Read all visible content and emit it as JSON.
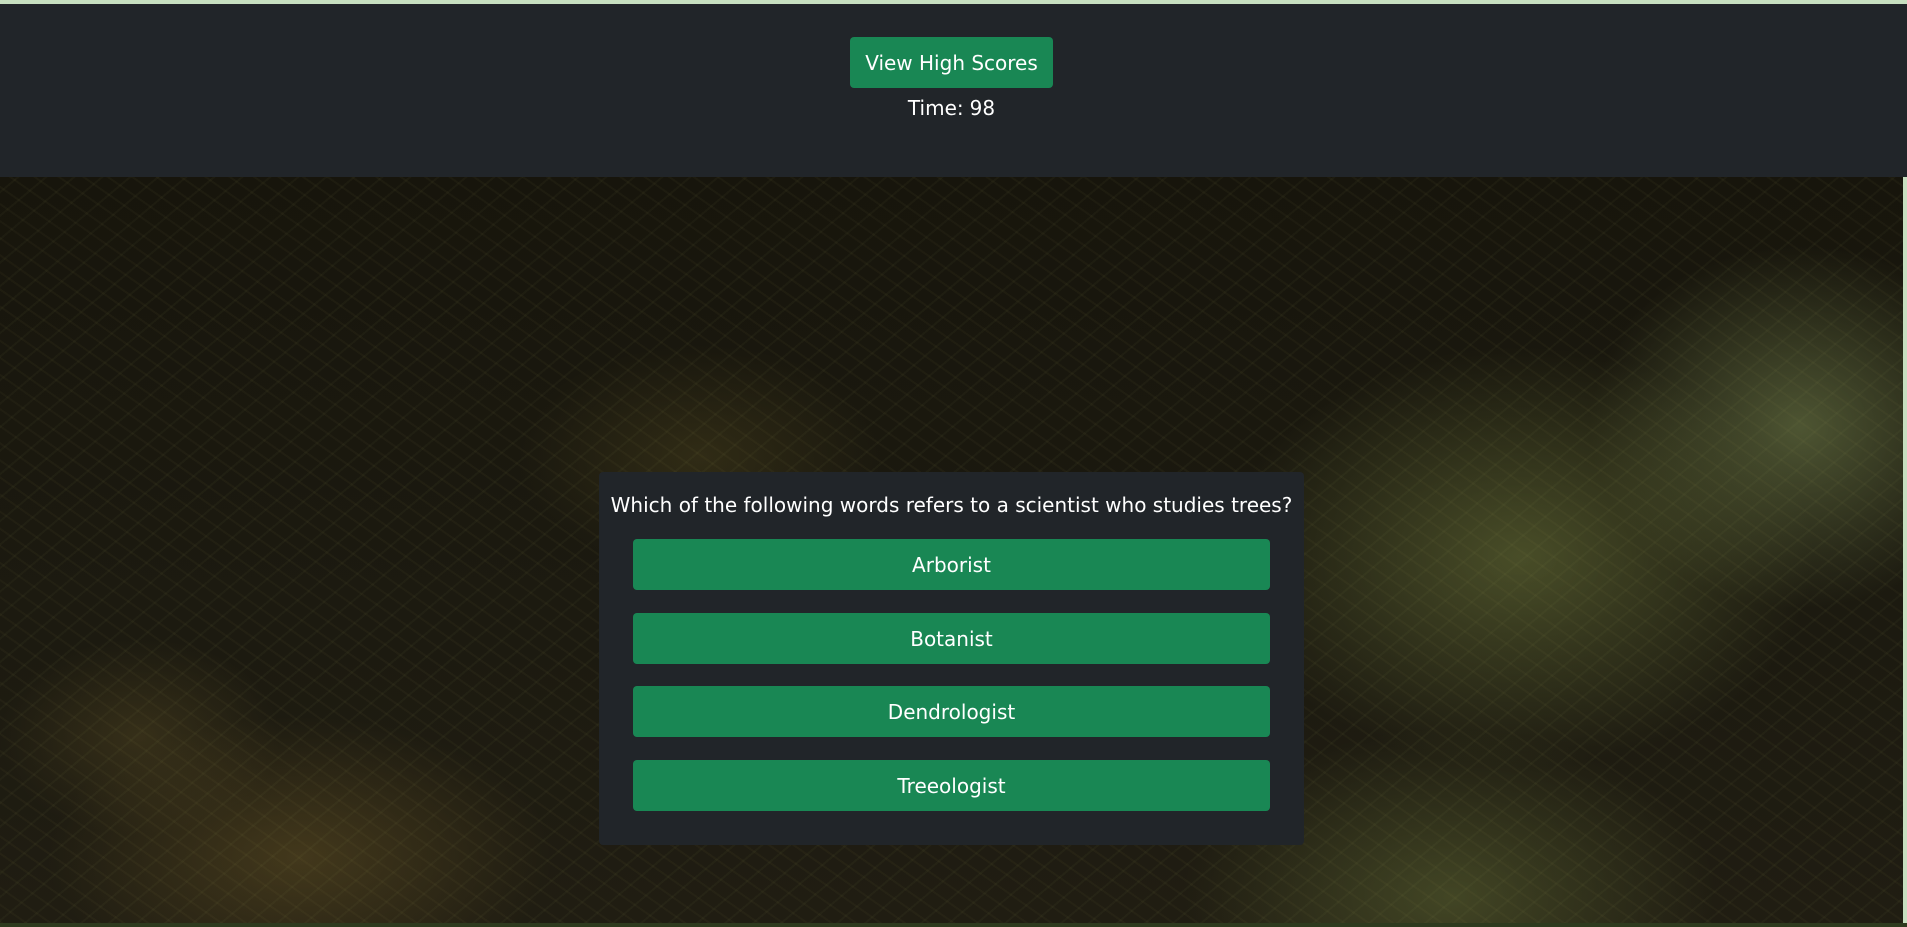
{
  "header": {
    "high_scores_label": "View High Scores",
    "timer_label": "Time:",
    "timer_value": "98"
  },
  "quiz": {
    "question": "Which of the following words refers to a scientist who studies trees?",
    "answers": [
      "Arborist",
      "Botanist",
      "Dendrologist",
      "Treeologist"
    ]
  },
  "colors": {
    "navbar_bg": "#212529",
    "button_green": "#198754",
    "text": "#ffffff"
  }
}
